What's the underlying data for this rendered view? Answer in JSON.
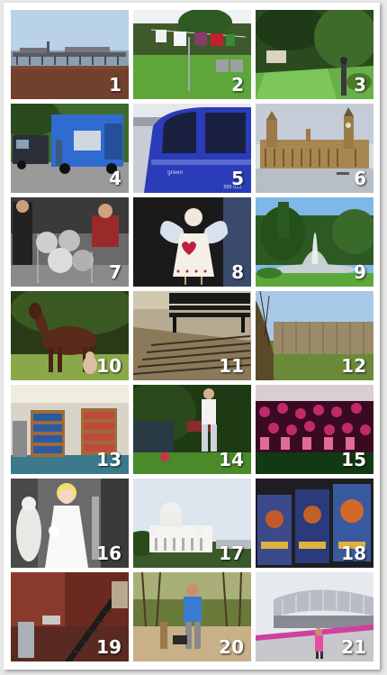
{
  "tiles": [
    {
      "number": "1",
      "scene": "pier-at-seafront"
    },
    {
      "number": "2",
      "scene": "washing-line-in-garden"
    },
    {
      "number": "3",
      "scene": "garden-path"
    },
    {
      "number": "4",
      "scene": "blue-food-van"
    },
    {
      "number": "5",
      "scene": "blue-train"
    },
    {
      "number": "6",
      "scene": "houses-of-parliament"
    },
    {
      "number": "7",
      "scene": "drum-kit-performers"
    },
    {
      "number": "8",
      "scene": "angel-figure"
    },
    {
      "number": "9",
      "scene": "park-fountain"
    },
    {
      "number": "10",
      "scene": "pony-in-field"
    },
    {
      "number": "11",
      "scene": "park-bench-shadow"
    },
    {
      "number": "12",
      "scene": "wooden-fence"
    },
    {
      "number": "13",
      "scene": "library-shelves"
    },
    {
      "number": "14",
      "scene": "boy-with-ball"
    },
    {
      "number": "15",
      "scene": "crowd-at-concert"
    },
    {
      "number": "16",
      "scene": "wedding-figurines"
    },
    {
      "number": "17",
      "scene": "white-temple"
    },
    {
      "number": "18",
      "scene": "brave-movie-posters"
    },
    {
      "number": "19",
      "scene": "brick-building-stairs"
    },
    {
      "number": "20",
      "scene": "man-in-playground"
    },
    {
      "number": "21",
      "scene": "olympic-stadium"
    }
  ],
  "colors": {
    "frame": "#ffffff",
    "background": "#e9e9e9",
    "label": "#ffffff"
  }
}
